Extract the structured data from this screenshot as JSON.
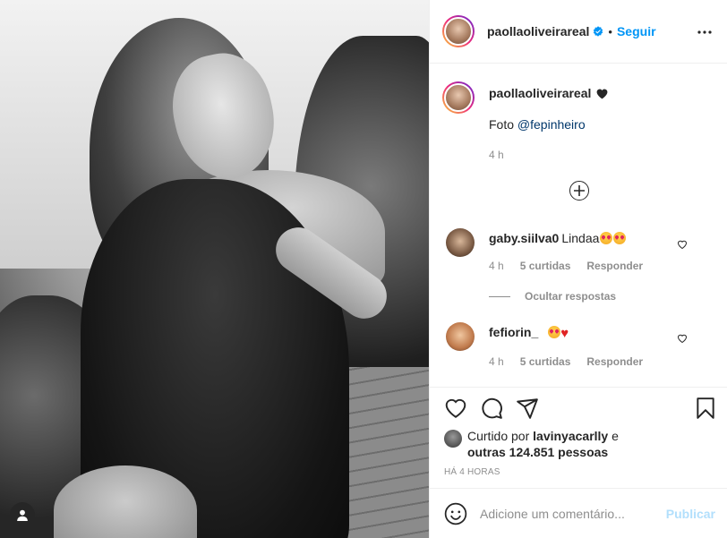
{
  "header": {
    "username": "paollaoliveirareal",
    "separator": "•",
    "follow_label": "Seguir"
  },
  "caption": {
    "username": "paollaoliveirareal",
    "text_prefix": "Foto ",
    "mention": "@fepinheiro",
    "time": "4 h"
  },
  "comments": [
    {
      "username": "gaby.siilva0",
      "text": "Lindaa",
      "time": "4 h",
      "likes": "5 curtidas",
      "reply_label": "Responder"
    },
    {
      "username": "fefiorin_",
      "text": "",
      "time": "4 h",
      "likes": "5 curtidas",
      "reply_label": "Responder"
    }
  ],
  "hide_replies_label": "Ocultar respostas",
  "likes": {
    "prefix": "Curtido por ",
    "user": "lavinyacarlly",
    "middle": " e",
    "others": "outras 124.851 pessoas"
  },
  "posted_ago": "HÁ 4 HORAS",
  "comment_box": {
    "placeholder": "Adicione um comentário...",
    "post_label": "Publicar"
  },
  "colors": {
    "link_blue": "#0095f6",
    "post_disabled": "#b2dffc",
    "secondary_text": "#8e8e8e",
    "primary_text": "#262626"
  },
  "icons": [
    "verified-badge-icon",
    "more-options-icon",
    "black-heart-icon",
    "load-more-icon",
    "heart-icon",
    "comment-icon",
    "share-icon",
    "bookmark-icon",
    "emoji-icon",
    "user-tag-icon",
    "heart-eyes-emoji",
    "red-heart-emoji"
  ]
}
